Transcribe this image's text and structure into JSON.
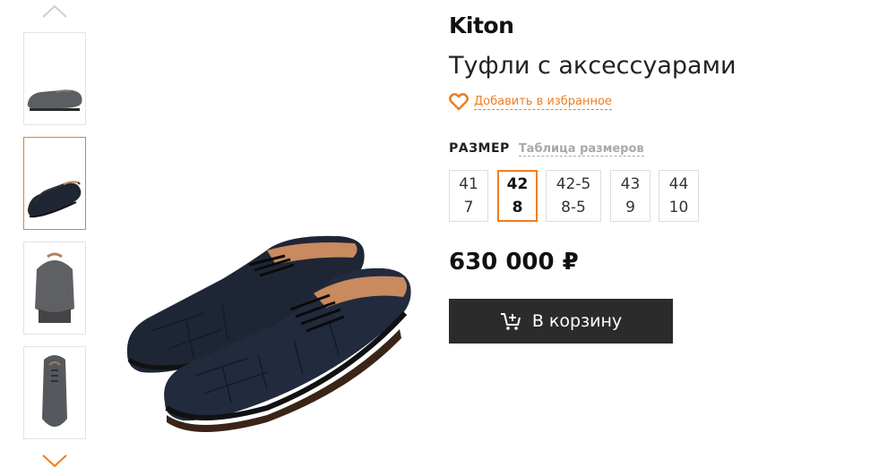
{
  "product": {
    "brand": "Kiton",
    "title": "Туфли с аксессуарами",
    "favorite_label": "Добавить в избранное",
    "price": "630 000 ₽",
    "cart_label": "В корзину"
  },
  "sizes": {
    "label": "РАЗМЕР",
    "table_link": "Таблица размеров",
    "options": [
      {
        "eu": "41",
        "uk": "7",
        "selected": false
      },
      {
        "eu": "42",
        "uk": "8",
        "selected": true
      },
      {
        "eu": "42-5",
        "uk": "8-5",
        "selected": false
      },
      {
        "eu": "43",
        "uk": "9",
        "selected": false
      },
      {
        "eu": "44",
        "uk": "10",
        "selected": false
      }
    ]
  },
  "gallery": {
    "thumbnail_count": 4,
    "active_index": 1,
    "icons": {
      "prev": "chevron-up-icon",
      "next": "chevron-down-icon",
      "favorite": "heart-icon",
      "cart": "cart-add-icon"
    }
  },
  "colors": {
    "accent": "#f07d1e",
    "button_bg": "#2b2b2b",
    "shoe": "#1e2636"
  }
}
